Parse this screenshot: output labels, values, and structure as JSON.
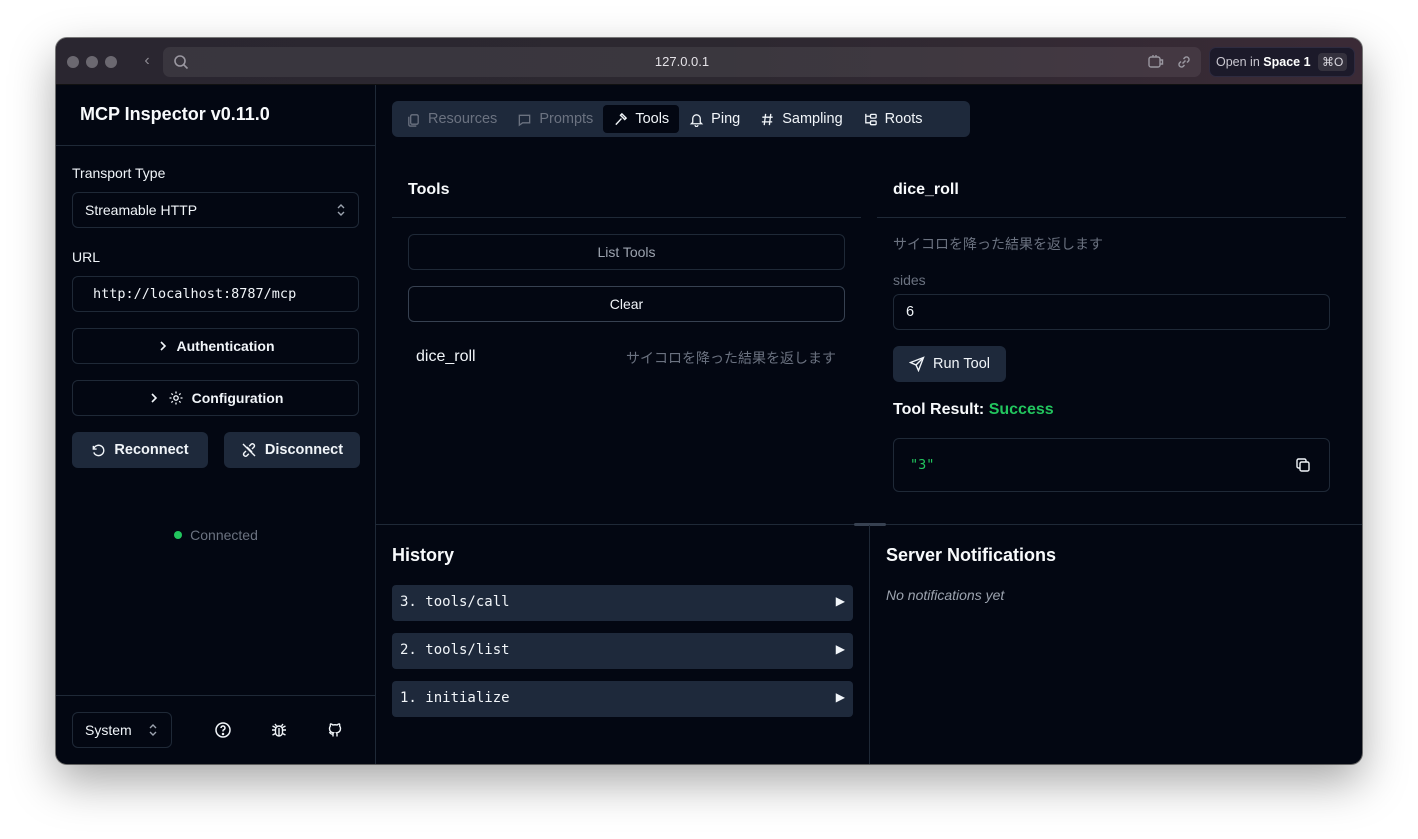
{
  "browser": {
    "url": "127.0.0.1",
    "open_in_prefix": "Open in",
    "open_in_target": "Space 1",
    "shortcut": "⌘O"
  },
  "sidebar": {
    "title": "MCP Inspector v0.11.0",
    "transport_label": "Transport Type",
    "transport_value": "Streamable HTTP",
    "url_label": "URL",
    "url_value": "http://localhost:8787/mcp",
    "authentication_label": "Authentication",
    "configuration_label": "Configuration",
    "reconnect_label": "Reconnect",
    "disconnect_label": "Disconnect",
    "status_text": "Connected",
    "status_color": "#22c55e",
    "theme_value": "System"
  },
  "tabs": [
    {
      "label": "Resources",
      "icon": "files-icon"
    },
    {
      "label": "Prompts",
      "icon": "message-icon"
    },
    {
      "label": "Tools",
      "icon": "hammer-icon"
    },
    {
      "label": "Ping",
      "icon": "bell-icon"
    },
    {
      "label": "Sampling",
      "icon": "hash-icon"
    },
    {
      "label": "Roots",
      "icon": "folder-tree-icon"
    }
  ],
  "tools_panel": {
    "title": "Tools",
    "list_button": "List Tools",
    "clear_button": "Clear",
    "items": [
      {
        "name": "dice_roll",
        "description": "サイコロを降った結果を返します"
      }
    ]
  },
  "tool_detail": {
    "title": "dice_roll",
    "description": "サイコロを降った結果を返します",
    "param_label": "sides",
    "param_value": "6",
    "run_button": "Run Tool",
    "result_label": "Tool Result:",
    "result_status": "Success",
    "result_value": "\"3\""
  },
  "history": {
    "title": "History",
    "items": [
      "3. tools/call",
      "2. tools/list",
      "1. initialize"
    ],
    "expand_glyph": "▶"
  },
  "notifications": {
    "title": "Server Notifications",
    "empty_text": "No notifications yet"
  }
}
